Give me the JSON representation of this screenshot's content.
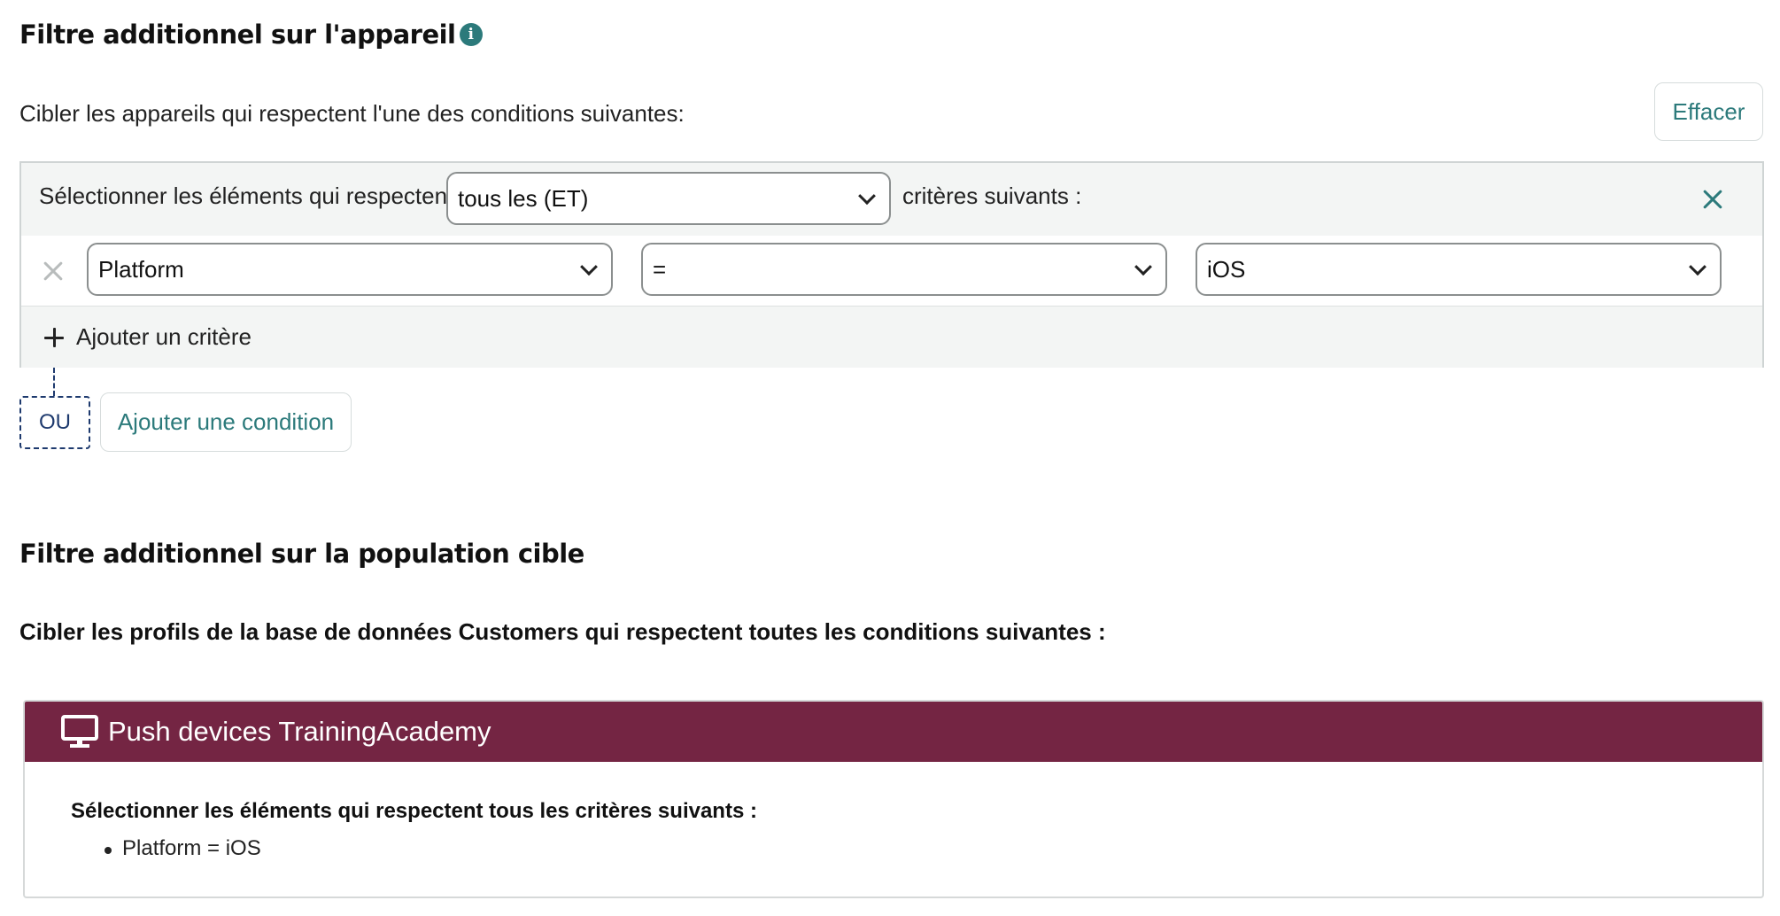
{
  "device_filter": {
    "title": "Filtre additionnel sur l'appareil",
    "info_icon": "i",
    "intro": "Cibler les appareils qui respectent l'une des conditions suivantes:",
    "clear_label": "Effacer",
    "condition": {
      "prefix": "Sélectionner les éléments qui respectent",
      "operator_select": "tous les (ET)",
      "suffix": "critères suivants :",
      "criteria": [
        {
          "field": "Platform",
          "operator": "=",
          "value": "iOS"
        }
      ],
      "add_criterion_label": "Ajouter un critère"
    },
    "or_label": "OU",
    "add_condition_label": "Ajouter une condition"
  },
  "population_filter": {
    "title": "Filtre additionnel sur la population cible",
    "intro": "Cibler les profils de la base de données Customers qui respectent toutes les conditions suivantes :",
    "card": {
      "icon": "monitor-icon",
      "title": "Push devices TrainingAcademy",
      "subtitle": "Sélectionner les éléments qui respectent tous les critères suivants :",
      "items": [
        "Platform = iOS"
      ]
    }
  },
  "colors": {
    "accent": "#2c7a7b",
    "card_header": "#742543",
    "or_border": "#1e3a6e"
  }
}
